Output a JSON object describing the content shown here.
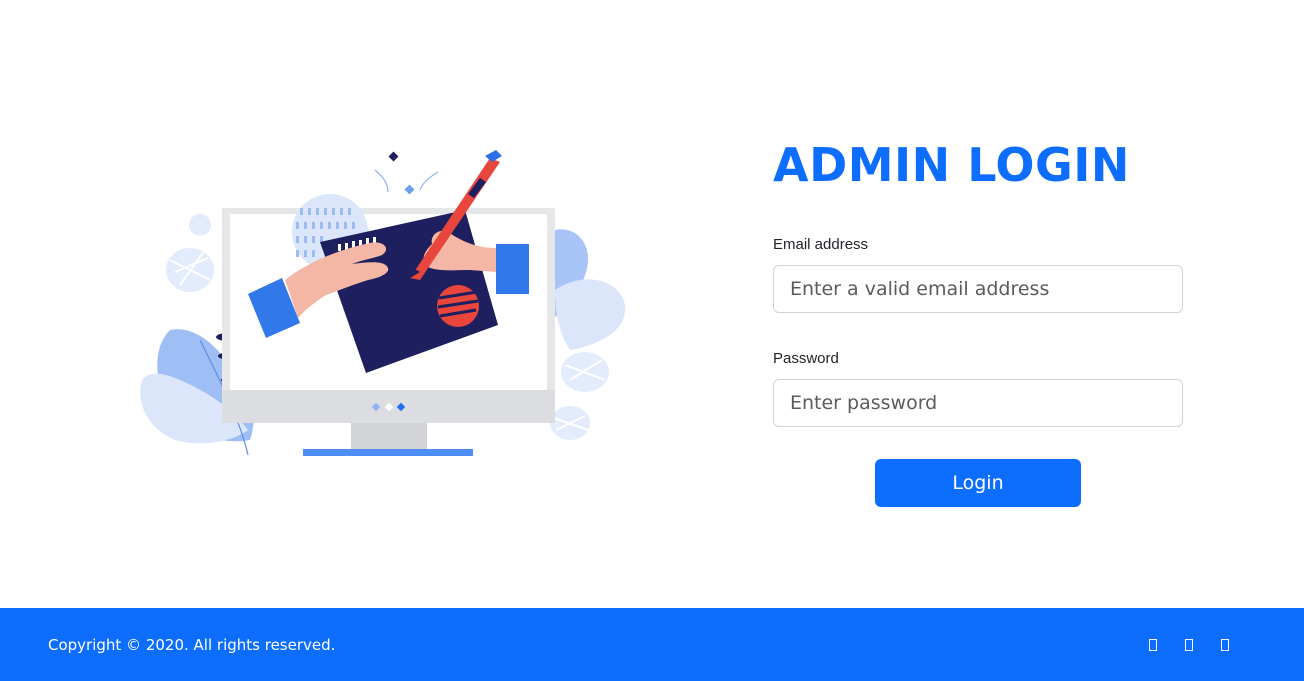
{
  "login": {
    "title": "ADMIN LOGIN",
    "email_label": "Email address",
    "email_placeholder": "Enter a valid email address",
    "email_value": "",
    "password_label": "Password",
    "password_placeholder": "Enter password",
    "password_value": "",
    "submit_label": "Login"
  },
  "footer": {
    "copyright": "Copyright © 2020. All rights reserved.",
    "social": [
      {
        "icon": "facebook-icon"
      },
      {
        "icon": "twitter-icon"
      },
      {
        "icon": "google-icon"
      }
    ]
  },
  "colors": {
    "primary": "#0d6efd",
    "navy": "#1d1f5e",
    "accent_red": "#e8453c"
  }
}
